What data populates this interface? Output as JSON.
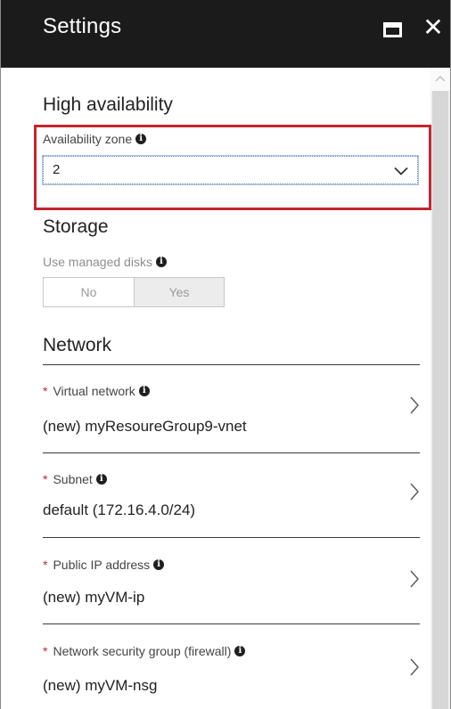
{
  "header": {
    "title": "Settings"
  },
  "high_availability": {
    "title": "High availability",
    "zone_label": "Availability zone",
    "zone_value": "2"
  },
  "storage": {
    "title": "Storage",
    "managed_disks_label": "Use managed disks",
    "options": [
      "No",
      "Yes"
    ],
    "selected": "Yes"
  },
  "network": {
    "title": "Network",
    "rows": [
      {
        "label": "Virtual network",
        "value": "(new) myResoureGroup9-vnet"
      },
      {
        "label": "Subnet",
        "value": "default (172.16.4.0/24)"
      },
      {
        "label": "Public IP address",
        "value": "(new) myVM-ip"
      },
      {
        "label": "Network security group (firewall)",
        "value": "(new) myVM-nsg"
      }
    ]
  },
  "colors": {
    "header_bg": "#1b1b1b",
    "highlight": "#c4262e",
    "required": "#c4262e"
  }
}
